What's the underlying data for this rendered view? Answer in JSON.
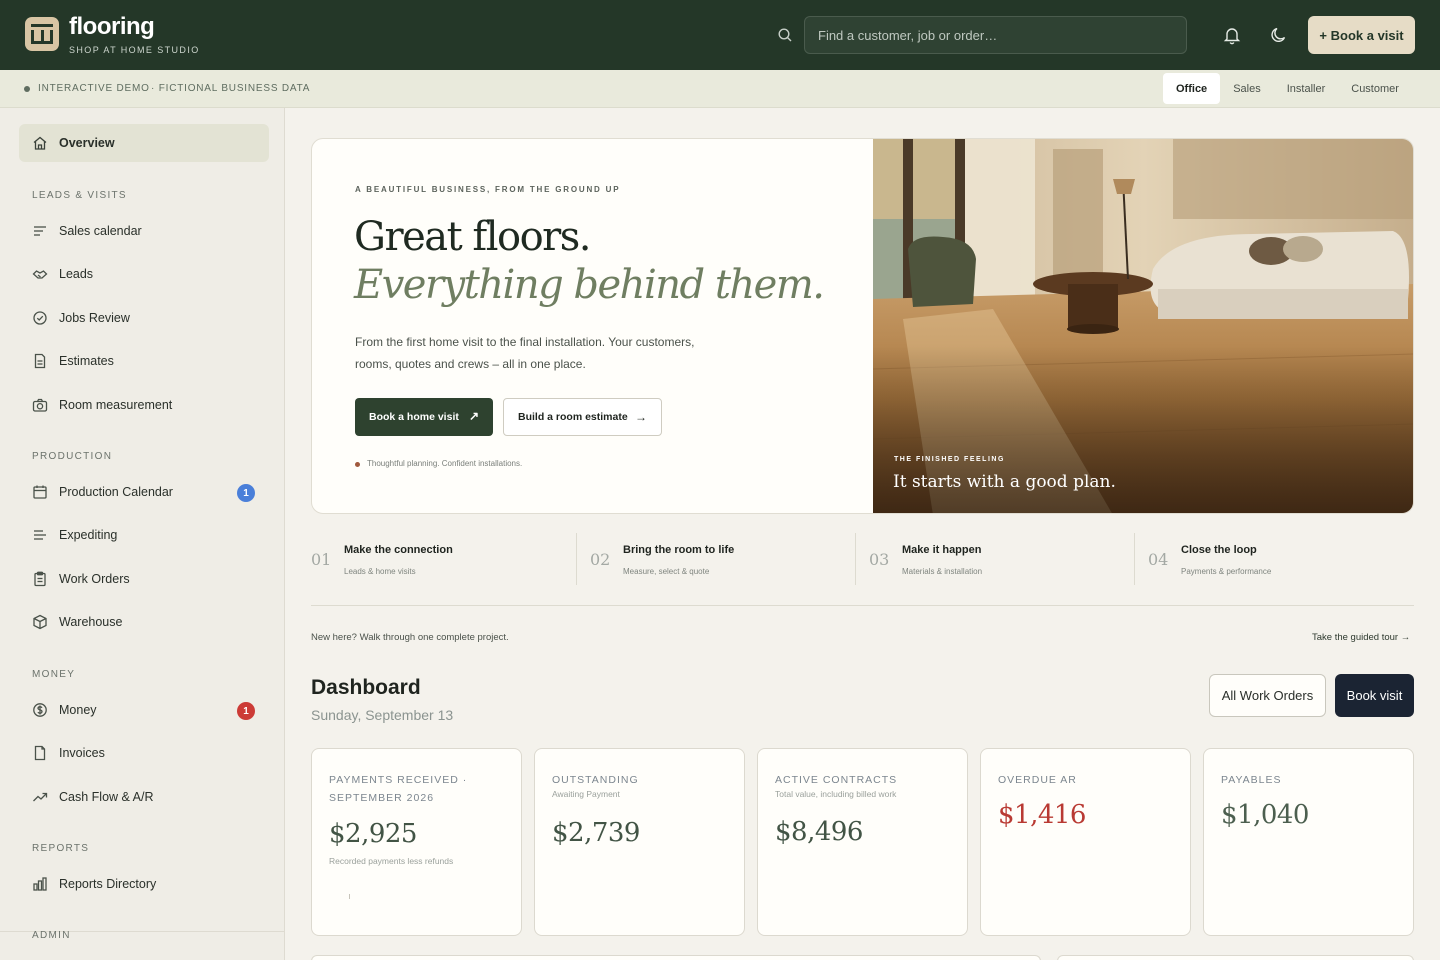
{
  "brand": {
    "name": "flooring",
    "subtitle": "SHOP AT HOME STUDIO"
  },
  "search": {
    "placeholder": "Find a customer, job or order…"
  },
  "header": {
    "book_label": "+ Book a visit"
  },
  "subbar": {
    "demo_label": "INTERACTIVE DEMO",
    "data_label": "· FICTIONAL BUSINESS DATA",
    "roles": [
      "Office",
      "Sales",
      "Installer",
      "Customer"
    ],
    "active_role": "Office"
  },
  "sidebar": {
    "overview": "Overview",
    "sections": {
      "leads": "LEADS & VISITS",
      "production": "PRODUCTION",
      "money": "MONEY",
      "reports": "REPORTS",
      "admin": "ADMIN"
    },
    "items": {
      "sales_calendar": "Sales calendar",
      "leads": "Leads",
      "jobs_review": "Jobs Review",
      "estimates": "Estimates",
      "room_measurement": "Room measurement",
      "production_calendar": "Production Calendar",
      "expediting": "Expediting",
      "work_orders": "Work Orders",
      "warehouse": "Warehouse",
      "money": "Money",
      "invoices": "Invoices",
      "cash_flow": "Cash Flow & A/R",
      "reports_directory": "Reports Directory"
    },
    "badges": {
      "production_calendar": "1",
      "money": "1"
    },
    "badge_colors": {
      "production_calendar": "#4a7fd9",
      "money": "#cc3b36"
    }
  },
  "hero": {
    "eyebrow": "A BEAUTIFUL BUSINESS, FROM THE GROUND UP",
    "title_line1": "Great floors.",
    "title_line2": "Everything behind them.",
    "description": "From the first home visit to the final installation. Your customers, rooms, quotes and crews – all in one place.",
    "primary_cta": "Book a home visit",
    "secondary_cta": "Build a room estimate",
    "tagline": "Thoughtful planning. Confident installations.",
    "image_eyebrow": "THE FINISHED FEELING",
    "image_caption": "It starts with a good plan."
  },
  "steps": [
    {
      "num": "01",
      "title": "Make the connection",
      "sub": "Leads & home visits"
    },
    {
      "num": "02",
      "title": "Bring the room to life",
      "sub": "Measure, select & quote"
    },
    {
      "num": "03",
      "title": "Make it happen",
      "sub": "Materials & installation"
    },
    {
      "num": "04",
      "title": "Close the loop",
      "sub": "Payments & performance"
    }
  ],
  "guide": {
    "new_here": "New here? Walk through one complete project.",
    "tour": "Take the guided tour →"
  },
  "dashboard": {
    "title": "Dashboard",
    "date": "Sunday, September 13",
    "all_orders": "All Work Orders",
    "book_visit": "Book visit",
    "cards": [
      {
        "label": "PAYMENTS RECEIVED · SEPTEMBER 2026",
        "sublabel": "",
        "value": "$2,925",
        "note": "Recorded payments less refunds",
        "color": "#425445"
      },
      {
        "label": "OUTSTANDING",
        "sublabel": "Awaiting Payment",
        "value": "$2,739",
        "note": "",
        "color": "#425445"
      },
      {
        "label": "ACTIVE CONTRACTS",
        "sublabel": "Total value, including billed work",
        "value": "$8,496",
        "note": "",
        "color": "#425445"
      },
      {
        "label": "OVERDUE AR",
        "sublabel": "",
        "value": "$1,416",
        "note": "",
        "color": "#b93a33"
      },
      {
        "label": "PAYABLES",
        "sublabel": "",
        "value": "$1,040",
        "note": "",
        "color": "#4c5f4f"
      }
    ]
  }
}
